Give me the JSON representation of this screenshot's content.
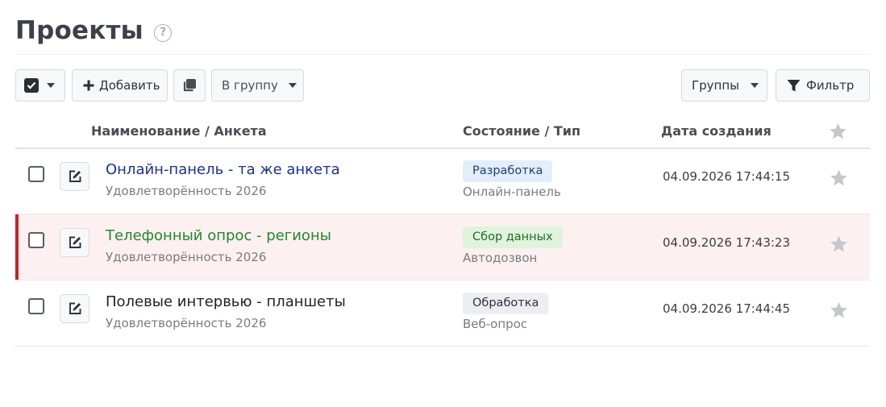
{
  "page": {
    "title": "Проекты",
    "help_icon": "?"
  },
  "toolbar": {
    "add_label": "Добавить",
    "group_select_label": "В группу",
    "groups_label": "Группы",
    "filter_label": "Фильтр"
  },
  "table": {
    "columns": [
      "Наименование / Анкета",
      "Состояние / Тип",
      "Дата создания"
    ],
    "rows": [
      {
        "name": "Онлайн-панель - та же анкета",
        "survey": "Удовлетворённость 2026",
        "status": "Разработка",
        "type": "Онлайн-панель",
        "date": "04.09.2026 17:44:15",
        "name_color": "#1a2ea0",
        "badge_bg": "#e3eefb",
        "badge_fg": "#1f3f7a",
        "highlighted": false
      },
      {
        "name": "Телефонный опрос - регионы",
        "survey": "Удовлетворённость 2026",
        "status": "Сбор данных",
        "type": "Автодозвон",
        "date": "04.09.2026 17:43:23",
        "name_color": "#1f8a2a",
        "badge_bg": "#dff3dd",
        "badge_fg": "#256b26",
        "highlighted": true
      },
      {
        "name": "Полевые интервью - планшеты",
        "survey": "Удовлетворённость 2026",
        "status": "Обработка",
        "type": "Веб-опрос",
        "date": "04.09.2026 17:44:45",
        "name_color": "#1f2126",
        "badge_bg": "#eceef1",
        "badge_fg": "#2f3238",
        "highlighted": false
      }
    ]
  },
  "colors": {
    "accent_red": "#cc2027",
    "star_gray": "#c4c7cc"
  },
  "icons": [
    "help-icon",
    "checkbox-icon",
    "plus-icon",
    "copy-icon",
    "chevron-down-icon",
    "filter-icon",
    "edit-icon",
    "star-icon"
  ]
}
